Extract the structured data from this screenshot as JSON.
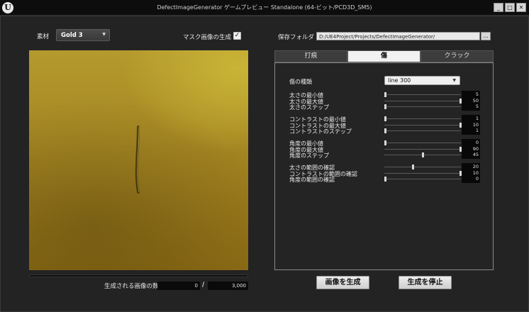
{
  "window": {
    "title": "DefectImageGenerator ゲームプレビュー Standalone (64-ビット/PCD3D_SM5)",
    "logo_text": "U",
    "buttons": {
      "minimize": "_",
      "maximize": "□",
      "close": "✕"
    }
  },
  "left": {
    "material_label": "素材",
    "material_value": "Gold 3",
    "mask_label": "マスク画像の生成",
    "mask_checked": true,
    "mask_check_glyph": "✓",
    "generated_count_label": "生成される画像の数",
    "generated_current": "0",
    "separator": "/",
    "generated_total": "3,000",
    "progress": 0
  },
  "right": {
    "save_folder_label": "保存フォルダ",
    "save_folder_path": "D:/UE4Project/Projects/DefectImageGenerator/",
    "browse_label": "...",
    "tabs": [
      {
        "label": "打痕",
        "active": false
      },
      {
        "label": "傷",
        "active": true
      },
      {
        "label": "クラック",
        "active": false
      }
    ],
    "scratch_type_label": "傷の種類",
    "scratch_type_value": "line 300",
    "params": [
      {
        "label": "太さの最小値",
        "value": "5",
        "fraction": 0.0
      },
      {
        "label": "太さの最大値",
        "value": "50",
        "fraction": 1.0
      },
      {
        "label": "太さのステップ",
        "value": "5",
        "fraction": 0.0
      },
      {
        "label": "コントラストの最小値",
        "value": "1",
        "fraction": 0.0
      },
      {
        "label": "コントラストの最大値",
        "value": "10",
        "fraction": 1.0
      },
      {
        "label": "コントラストのステップ",
        "value": "1",
        "fraction": 0.0
      },
      {
        "label": "角度の最小値",
        "value": "0",
        "fraction": 0.0
      },
      {
        "label": "角度の最大値",
        "value": "90",
        "fraction": 1.0
      },
      {
        "label": "角度のステップ",
        "value": "45",
        "fraction": 0.5
      },
      {
        "label": "太さの範囲の確認",
        "value": "20",
        "fraction": 0.37
      },
      {
        "label": "コントラストの範囲の確認",
        "value": "10",
        "fraction": 1.0
      },
      {
        "label": "角度の範囲の確認",
        "value": "0",
        "fraction": 0.0
      }
    ],
    "generate_button": "画像を生成",
    "stop_button": "生成を停止"
  },
  "colors": {
    "background": "#232323",
    "gold_light": "#c9b436",
    "gold_dark": "#8a6a14"
  },
  "icons": {
    "dropdown_arrow": "chevron-down-icon",
    "checkbox": "check-icon",
    "logo": "unreal-logo-icon"
  }
}
